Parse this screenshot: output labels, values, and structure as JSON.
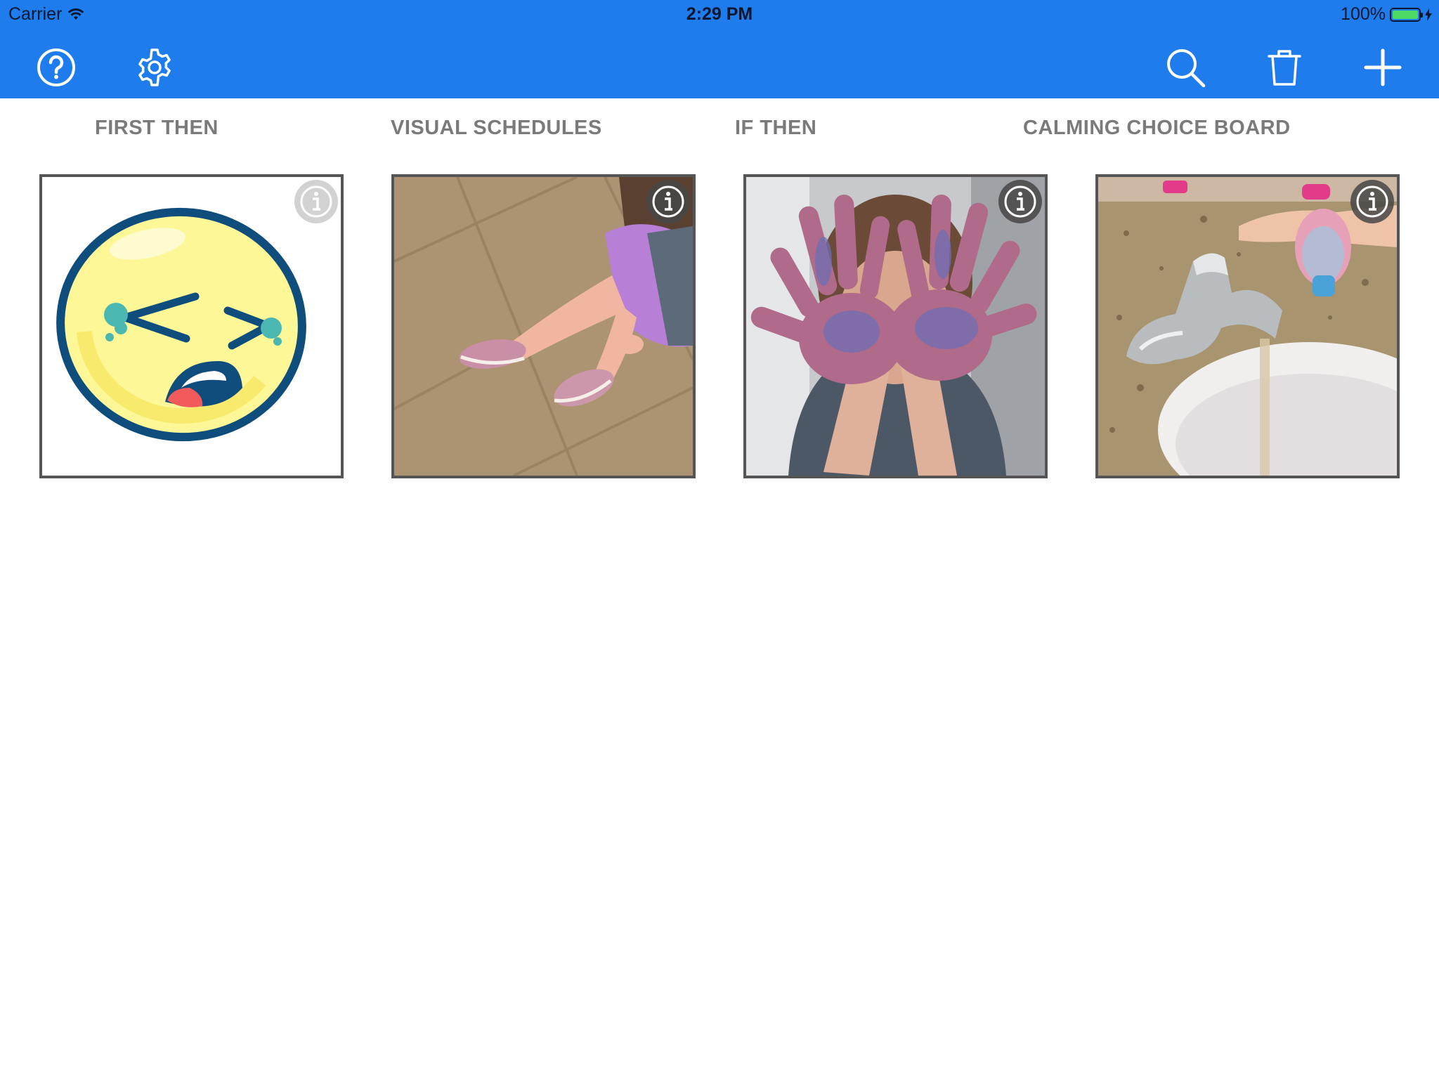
{
  "status_bar": {
    "carrier": "Carrier",
    "time": "2:29 PM",
    "battery_percent": "100%",
    "battery_level": 1.0
  },
  "nav": {
    "left_buttons": [
      {
        "icon": "help-icon"
      },
      {
        "icon": "gear-icon"
      }
    ],
    "right_buttons": [
      {
        "icon": "search-icon"
      },
      {
        "icon": "trash-icon"
      },
      {
        "icon": "plus-icon"
      }
    ]
  },
  "categories": [
    {
      "label": "FIRST THEN",
      "image": "crying-emoji",
      "info_icon": "info-icon"
    },
    {
      "label": "VISUAL SCHEDULES",
      "image": "child-putting-on-shoes-photo",
      "info_icon": "info-icon"
    },
    {
      "label": "IF THEN",
      "image": "child-painted-hands-photo",
      "info_icon": "info-icon"
    },
    {
      "label": "CALMING CHOICE BOARD",
      "image": "handwashing-sink-photo",
      "info_icon": "info-icon"
    }
  ],
  "colors": {
    "nav_background": "#1f7cec",
    "label_text": "#7a7a7a",
    "card_border": "#555555",
    "battery": "#4cd964"
  }
}
